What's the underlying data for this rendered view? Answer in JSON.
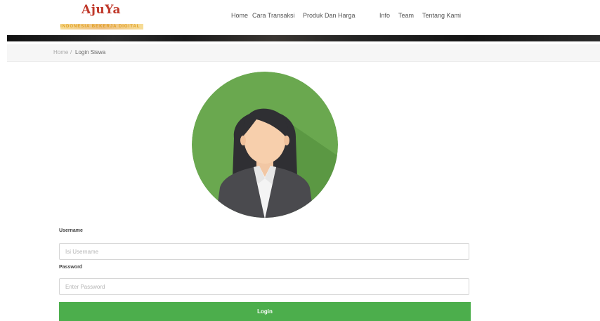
{
  "header": {
    "logo_text": "AjuYa",
    "logo_tagline": "INDONESIA BEKERJA DIGITAL",
    "nav": [
      {
        "label": "Home"
      },
      {
        "label": "Cara Transaksi"
      },
      {
        "label": "Produk Dan Harga"
      },
      {
        "label": "Info"
      },
      {
        "label": "Team"
      },
      {
        "label": "Tentang Kami"
      }
    ]
  },
  "breadcrumb": {
    "home": "Home",
    "separator": "/",
    "current": "Login Siswa"
  },
  "form": {
    "username_label": "Username",
    "username_placeholder": "Isi Username",
    "password_label": "Password",
    "password_placeholder": "Enter Password",
    "login_label": "Login"
  },
  "colors": {
    "avatar_bg": "#6aa84f",
    "login_button": "#4cae4c",
    "logo_red": "#c0392b",
    "logo_gold": "#e0a020"
  }
}
